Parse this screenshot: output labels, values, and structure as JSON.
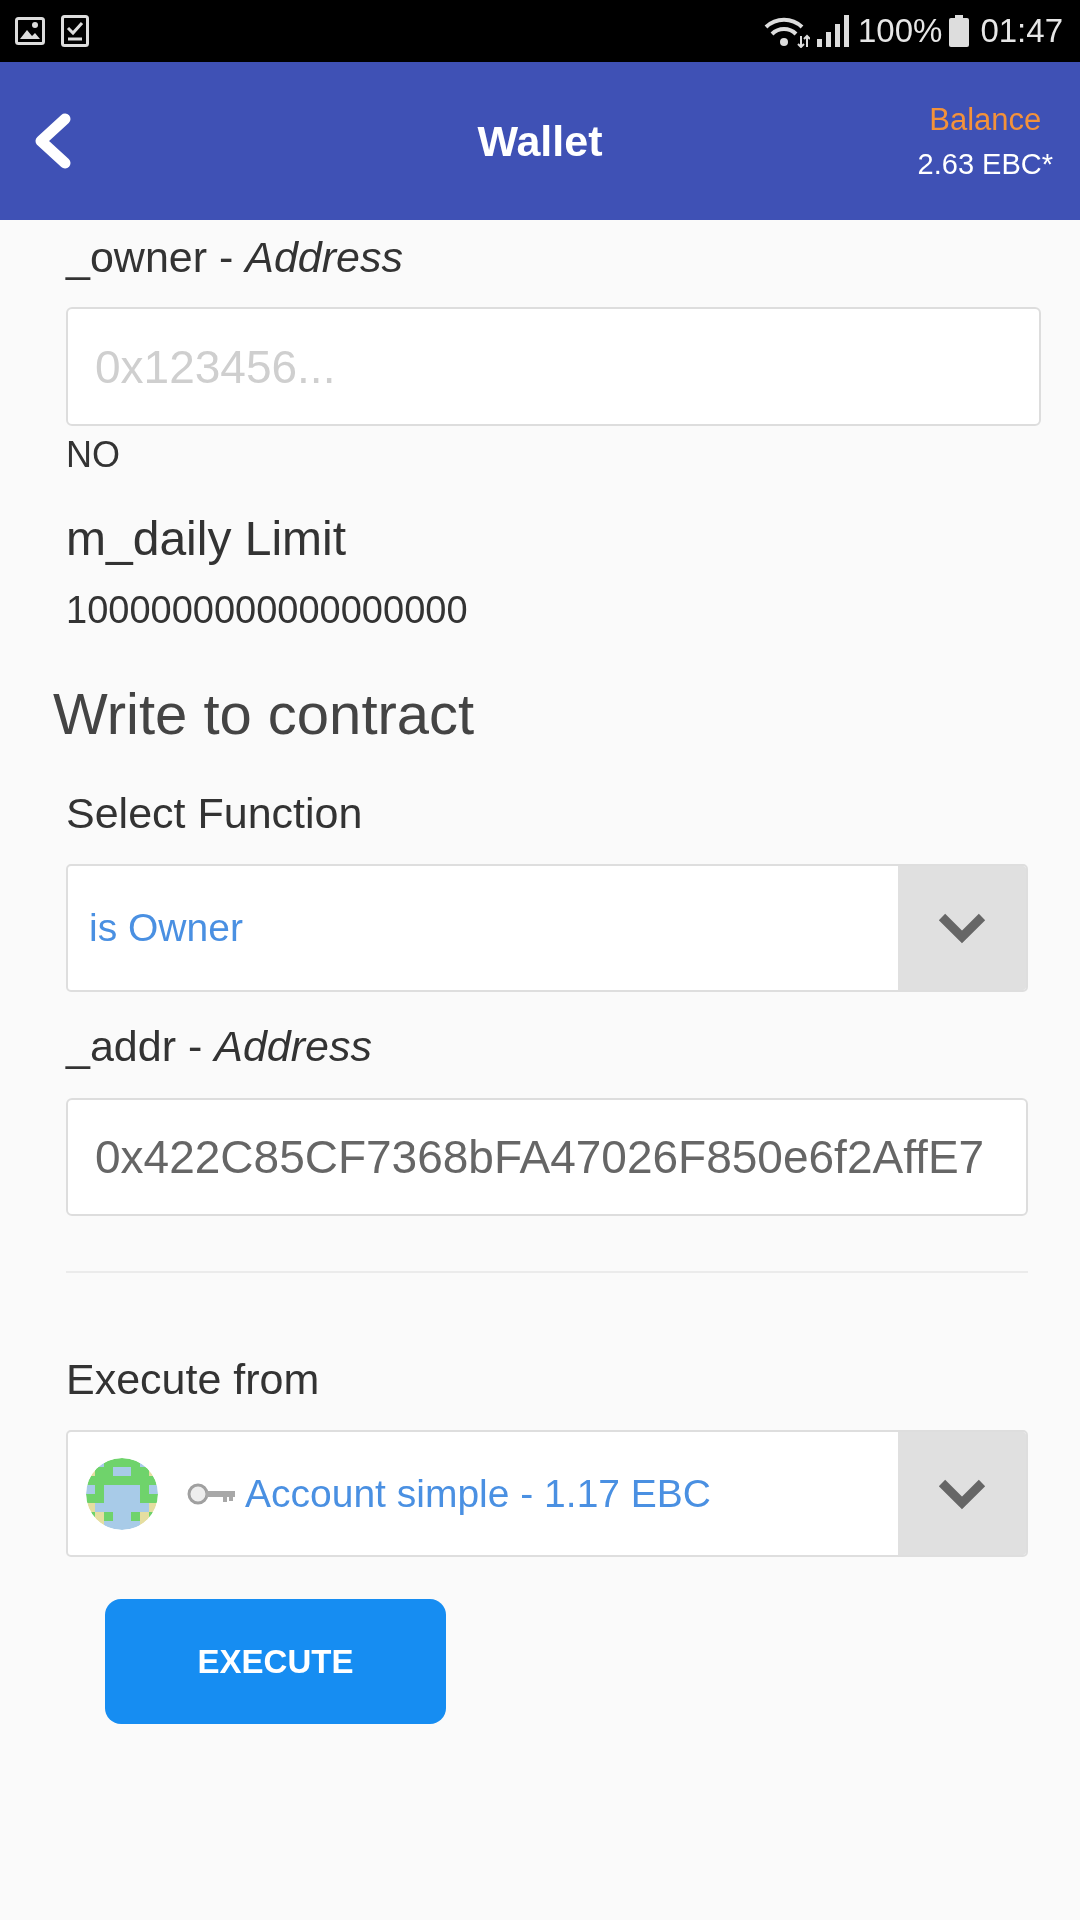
{
  "status_bar": {
    "battery": "100%",
    "time": "01:47"
  },
  "header": {
    "title": "Wallet",
    "balance_label": "Balance",
    "balance_value": "2.63 EBC*"
  },
  "read_items": [
    {
      "kind": "input",
      "label": "_owner - *Address*",
      "placeholder": "0x123456...",
      "result": "NO"
    },
    {
      "kind": "value",
      "label": "m_daily Limit",
      "value": "1000000000000000000"
    }
  ],
  "write_section": {
    "title": "Write to contract",
    "function_label": "Select Function",
    "function_value": "is Owner",
    "inputs": [
      {
        "label": "_addr - *Address*",
        "value": "0x422C85CF7368bFA47026F850e6f2AffE7"
      }
    ],
    "execute_label": "Execute from",
    "account": "Account simple - 1.17 EBC",
    "button": "EXECUTE"
  }
}
